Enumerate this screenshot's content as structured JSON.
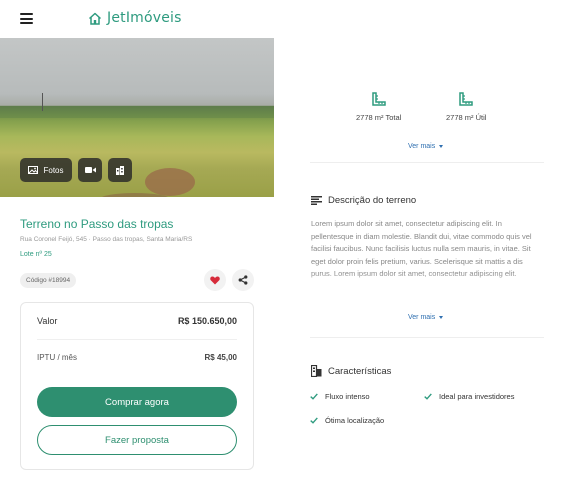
{
  "header": {
    "brand_name": "JetImóveis",
    "menu_icon": "hamburger-menu-icon",
    "brand_icon": "house-icon"
  },
  "media": {
    "photos_label": "Fotos",
    "buttons": [
      "photos-icon",
      "video-icon",
      "map-icon"
    ]
  },
  "property": {
    "title": "Terreno no Passo das tropas",
    "address": "Rua Coronel Feijó, 545 · Passo das tropas, Santa Maria/RS",
    "lot": "Lote nº 25",
    "code": "Código #18994"
  },
  "pricing": {
    "value_label": "Valor",
    "value": "R$ 150.650,00",
    "iptu_label": "IPTU / mês",
    "iptu_value": "R$ 45,00",
    "buy_label": "Comprar agora",
    "offer_label": "Fazer proposta"
  },
  "areas": [
    {
      "label": "2778 m² Total",
      "icon": "ruler-area-icon"
    },
    {
      "label": "2778 m² Útil",
      "icon": "ruler-area-icon"
    }
  ],
  "see_more_label": "Ver mais",
  "description": {
    "title": "Descrição do terreno",
    "text": "Lorem ipsum dolor sit amet, consectetur adipiscing elit. In pellentesque in diam molestie. Blandit dui, vitae commodo quis vel facilisi faucibus. Nunc facilisis luctus nulla sem mauris, in vitae. Sit eget dolor proin felis pretium, varius. Scelerisque sit mattis a dis purus. Lorem ipsum dolor sit amet, consectetur adipiscing elit."
  },
  "features": {
    "title": "Características",
    "items": [
      "Fluxo intenso",
      "Ideal para investidores",
      "Ótima localização"
    ]
  },
  "colors": {
    "accent": "#2e9b7f",
    "button": "#2e8f70",
    "link": "#2e6fb0",
    "heart": "#d62b3a"
  }
}
